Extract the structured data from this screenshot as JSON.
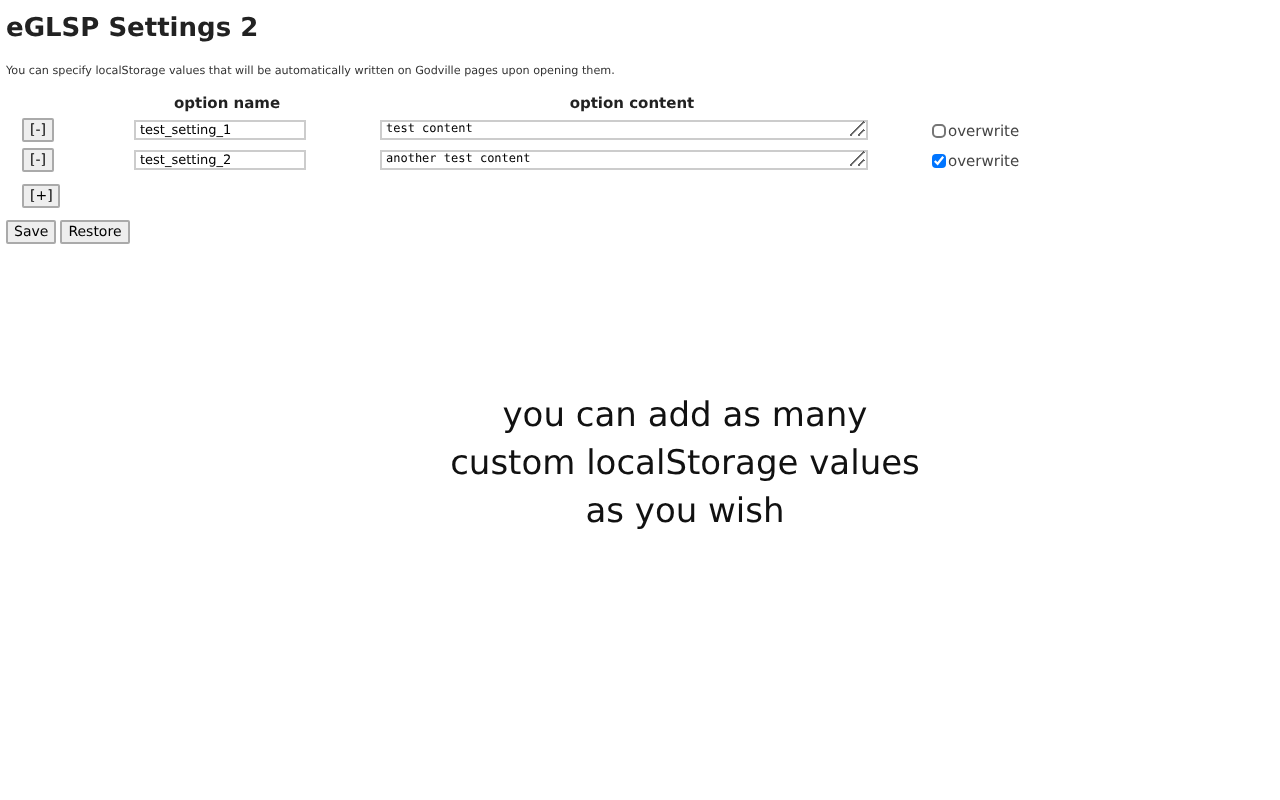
{
  "title": "eGLSP Settings 2",
  "description": "You can specify localStorage values that will be automatically written on Godville pages upon opening them.",
  "table": {
    "columns": [
      "option name",
      "option content"
    ],
    "rows": [
      {
        "remove_button": "[-]",
        "name": "test_setting_1",
        "content": "test content",
        "overwrite_label": "overwrite",
        "checked": false
      },
      {
        "remove_button": "[-]",
        "name": "test_setting_2",
        "content": "another test content",
        "overwrite_label": "overwrite",
        "checked": true
      }
    ]
  },
  "add_button": "[+]",
  "buttons": [
    "Save",
    "Restore"
  ],
  "caption": "you can add as many custom localStorage values as you wish"
}
